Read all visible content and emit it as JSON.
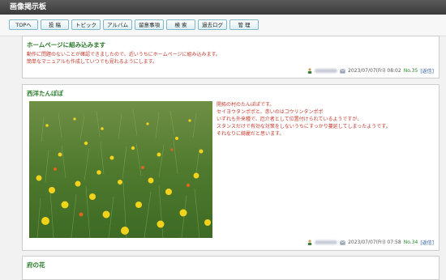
{
  "header": {
    "title": "画像掲示板"
  },
  "nav": {
    "items": [
      "TOPへ",
      "投 稿",
      "トピック",
      "アルバム",
      "留意事項",
      "検 索",
      "過去ログ",
      "管 理"
    ]
  },
  "posts": [
    {
      "title": "ホームページに組み込みます",
      "body": [
        "動作に問題のないことが確認できましたので、近いうちにホームページに組み込みます。",
        "簡単なマニュアルも作成していつでも見れるようにします。"
      ],
      "date": "2023/07/07(Fri) 08:02",
      "no": "No.35",
      "reply": "[返信]"
    },
    {
      "title": "西洋たんぽぽ",
      "body": [
        "開拓の村のたんぽぽです。",
        "セイヨウタンポポと、赤いのはコウリンタンポポ",
        "いずれも外来種で、厄介者として位置付けられているようですが、",
        "スタンスだけで有効な対策をしないうちにすっかり蔓延してしまったようです。",
        "それなりに綺麗だと思います。"
      ],
      "date": "2023/07/07(Fri) 07:58",
      "no": "No.34",
      "reply": "[返信]",
      "image": "dandelion-field-photo"
    },
    {
      "title": "府の花"
    }
  ],
  "colors": {
    "title_green": "#2a7a2a",
    "body_red": "#c0392b",
    "nav_border": "#7fb8c8"
  }
}
